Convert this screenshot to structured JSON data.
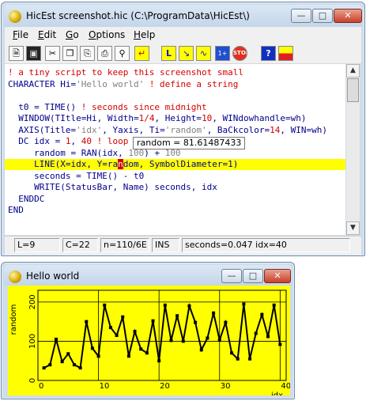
{
  "editor_window": {
    "title": "HicEst screenshot.hic (C:\\ProgramData\\HicEst\\)",
    "menus": [
      "File",
      "Edit",
      "Go",
      "Options",
      "Help"
    ],
    "toolbar_icons": [
      "new-file-icon",
      "save-icon",
      "cut-icon",
      "copy-icon",
      "paste-icon",
      "print-icon",
      "find-icon",
      "return-icon",
      "l-shape-icon",
      "staircase-icon",
      "wave-icon",
      "count-icon",
      "stop-icon",
      "help-icon",
      "grid-icon"
    ],
    "code_lines": [
      {
        "segments": [
          {
            "t": "! a tiny script to keep this screenshot small",
            "k": "c"
          }
        ]
      },
      {
        "segments": [
          {
            "t": "CHARACTER Hi=",
            "k": "k"
          },
          {
            "t": "'Hello world'",
            "k": "s"
          },
          {
            "t": " ",
            "k": "k"
          },
          {
            "t": "! define a string",
            "k": "c"
          }
        ]
      },
      {
        "segments": []
      },
      {
        "segments": [
          {
            "t": "  t0 = TIME() ",
            "k": "k"
          },
          {
            "t": "! seconds since midnight",
            "k": "c"
          }
        ]
      },
      {
        "segments": [
          {
            "t": "  WINDOW(TItle=Hi, Width=",
            "k": "k"
          },
          {
            "t": "1/4",
            "k": "n"
          },
          {
            "t": ", Height=",
            "k": "k"
          },
          {
            "t": "10",
            "k": "n"
          },
          {
            "t": ", WINdowhandle=wh)",
            "k": "k"
          }
        ]
      },
      {
        "segments": [
          {
            "t": "  AXIS(Title=",
            "k": "k"
          },
          {
            "t": "'idx'",
            "k": "s"
          },
          {
            "t": ", Yaxis, Ti=",
            "k": "k"
          },
          {
            "t": "'random'",
            "k": "s"
          },
          {
            "t": ", BaCkcolor=",
            "k": "k"
          },
          {
            "t": "14",
            "k": "n"
          },
          {
            "t": ", WIN=wh)",
            "k": "k"
          }
        ]
      },
      {
        "segments": [
          {
            "t": "  DC idx = ",
            "k": "k"
          },
          {
            "t": "1",
            "k": "n"
          },
          {
            "t": ", ",
            "k": "k"
          },
          {
            "t": "40",
            "k": "n"
          },
          {
            "t": " ",
            "k": "k"
          },
          {
            "t": "! loop 1 to 40 step 1",
            "k": "c"
          }
        ]
      },
      {
        "segments": [
          {
            "t": "     random = RAN(idx, ",
            "k": "k"
          },
          {
            "t": "100",
            "k": "s"
          },
          {
            "t": ") + ",
            "k": "k"
          },
          {
            "t": "100",
            "k": "s"
          }
        ]
      },
      {
        "segments": [
          {
            "t": "     LINE(X=idx, Y=ra",
            "k": "k"
          },
          {
            "t": "n",
            "k": "cur"
          },
          {
            "t": "dom, SymbolDiameter=1)",
            "k": "k"
          }
        ],
        "highlight": true
      },
      {
        "segments": [
          {
            "t": "     seconds = TIME() - t0",
            "k": "k"
          }
        ]
      },
      {
        "segments": [
          {
            "t": "     WRITE(StatusBar, Name) seconds, idx",
            "k": "k"
          }
        ]
      },
      {
        "segments": [
          {
            "t": "  ENDDC",
            "k": "k"
          }
        ]
      },
      {
        "segments": [
          {
            "t": "END",
            "k": "k"
          }
        ]
      }
    ],
    "tooltip": "random = 81.61487433",
    "status": {
      "line": "L=9",
      "col": "C=22",
      "count": "n=110/6E",
      "mode": "INS",
      "message": "seconds=0.047 idx=40"
    }
  },
  "plot_window": {
    "title": "Hello world",
    "colors": {
      "background": "#ffff00",
      "line": "#000000"
    }
  },
  "chart_data": {
    "type": "line",
    "title": "",
    "xlabel": "idx",
    "ylabel": "random",
    "x_ticks": [
      "0",
      "10",
      "20",
      "30",
      "40"
    ],
    "y_ticks": [
      "0",
      "100",
      "200"
    ],
    "xlim": [
      0,
      41
    ],
    "ylim": [
      0,
      230
    ],
    "grid": true,
    "series": [
      {
        "x": [
          1,
          2,
          3,
          4,
          5,
          6,
          7,
          8,
          9,
          10,
          11,
          12,
          13,
          14,
          15,
          16,
          17,
          18,
          19,
          20,
          21,
          22,
          23,
          24,
          25,
          26,
          27,
          28,
          29,
          30,
          31,
          32,
          33,
          34,
          35,
          36,
          37,
          38,
          39,
          40
        ],
        "values": [
          32,
          40,
          105,
          48,
          68,
          40,
          32,
          150,
          82,
          62,
          192,
          135,
          115,
          162,
          62,
          125,
          80,
          70,
          152,
          50,
          192,
          102,
          165,
          100,
          190,
          148,
          78,
          108,
          172,
          103,
          148,
          70,
          55,
          195,
          55,
          120,
          168,
          112,
          192,
          92
        ]
      }
    ]
  }
}
